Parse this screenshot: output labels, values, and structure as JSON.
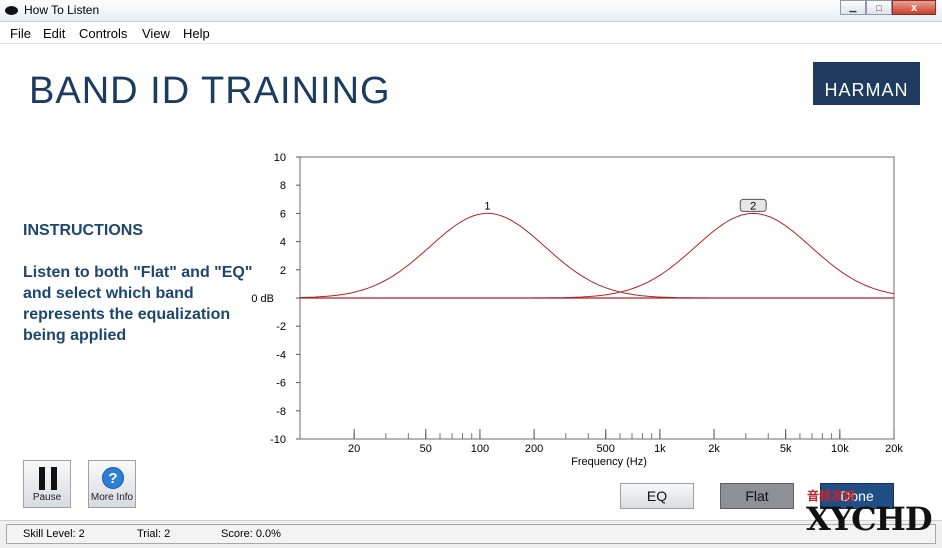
{
  "window": {
    "title": "How To Listen",
    "minimize_glyph": "▁",
    "maximize_glyph": "□",
    "close_glyph": "x"
  },
  "menu": [
    "File",
    "Edit",
    "Controls",
    "View",
    "Help"
  ],
  "app": {
    "title": "BAND ID TRAINING",
    "brand": "HARMAN"
  },
  "instructions": {
    "heading": "INSTRUCTIONS",
    "body": "Listen to both \"Flat\" and \"EQ\" and select which band represents the equalization being applied"
  },
  "chart_data": {
    "type": "line",
    "xlabel": "Frequency (Hz)",
    "ylabel": "",
    "x_scale": "log",
    "xlim": [
      10,
      20000
    ],
    "ylim": [
      -10,
      10
    ],
    "x_ticks": [
      20,
      50,
      100,
      200,
      500,
      1000,
      2000,
      5000,
      10000,
      20000
    ],
    "x_tick_labels": [
      "20",
      "50",
      "100",
      "200",
      "500",
      "1k",
      "2k",
      "5k",
      "10k",
      "20k"
    ],
    "y_ticks": [
      10,
      8,
      6,
      4,
      2,
      0,
      -2,
      -4,
      -6,
      -8,
      -10
    ],
    "y_tick_labels": [
      "10",
      "8",
      "6",
      "4",
      "2",
      "0 dB",
      "-2",
      "-4",
      "-6",
      "-8",
      "-10"
    ],
    "grid": false,
    "series": [
      {
        "name": "1",
        "center_hz": 110,
        "peak_db": 6,
        "color": "#b22222"
      },
      {
        "name": "2",
        "center_hz": 3300,
        "peak_db": 6,
        "color": "#b22222",
        "selected": true
      }
    ],
    "baseline_db": 0
  },
  "buttons": {
    "pause": "Pause",
    "more_info": "More Info",
    "more_info_glyph": "?",
    "eq": "EQ",
    "flat": "Flat",
    "done": "Done"
  },
  "status": {
    "skill": "Skill Level: 2",
    "trial": "Trial: 2",
    "score": "Score: 0.0%"
  },
  "watermark": {
    "line1": "音频发烧",
    "line2": "XYCHD"
  },
  "colors": {
    "title": "#1c3b63",
    "instructions": "#1c4670",
    "brand_bg": "#1e3a5f",
    "curve": "#b22222"
  }
}
